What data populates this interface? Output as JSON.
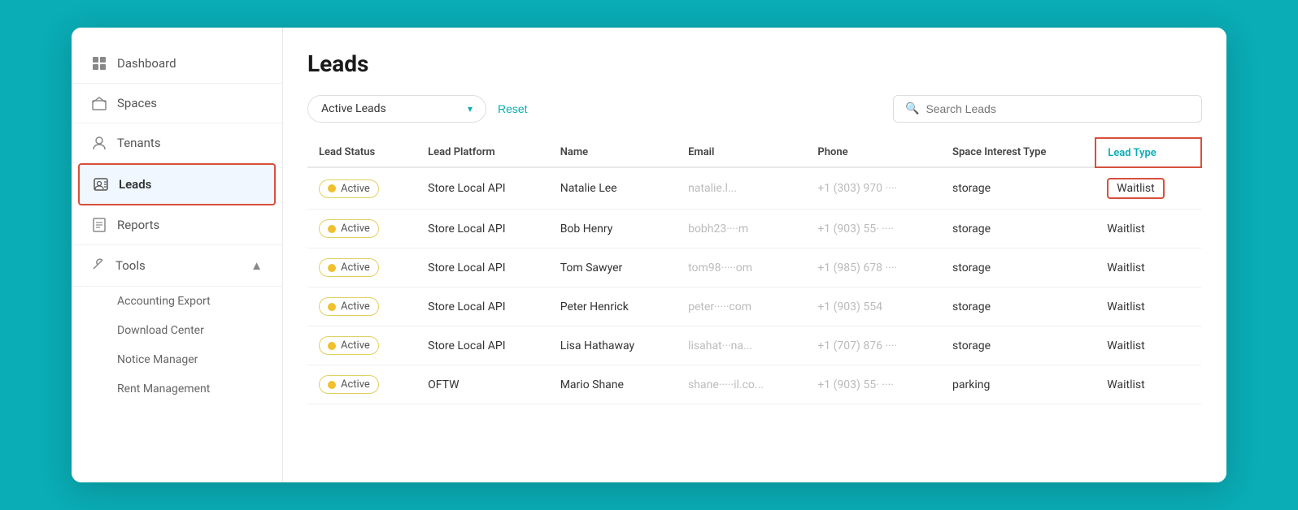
{
  "sidebar": {
    "items": [
      {
        "label": "Dashboard",
        "icon": "grid",
        "active": false
      },
      {
        "label": "Spaces",
        "icon": "building",
        "active": false
      },
      {
        "label": "Tenants",
        "icon": "person",
        "active": false
      },
      {
        "label": "Leads",
        "icon": "contact-card",
        "active": true
      },
      {
        "label": "Reports",
        "icon": "document",
        "active": false
      }
    ],
    "tools": {
      "label": "Tools",
      "icon": "wrench",
      "sub_items": [
        {
          "label": "Accounting Export"
        },
        {
          "label": "Download Center"
        },
        {
          "label": "Notice Manager"
        },
        {
          "label": "Rent Management"
        }
      ]
    }
  },
  "page": {
    "title": "Leads"
  },
  "toolbar": {
    "filter_label": "Active Leads",
    "filter_chevron": "▾",
    "reset_label": "Reset",
    "search_placeholder": "Search Leads"
  },
  "table": {
    "columns": [
      {
        "id": "lead_status",
        "label": "Lead Status"
      },
      {
        "id": "lead_platform",
        "label": "Lead Platform"
      },
      {
        "id": "name",
        "label": "Name"
      },
      {
        "id": "email",
        "label": "Email"
      },
      {
        "id": "phone",
        "label": "Phone"
      },
      {
        "id": "space_interest_type",
        "label": "Space Interest Type"
      },
      {
        "id": "lead_type",
        "label": "Lead Type",
        "highlight": true
      }
    ],
    "rows": [
      {
        "status": "Active",
        "platform": "Store Local API",
        "name": "Natalie Lee",
        "email": "natalie.l...",
        "phone": "+1 (303) 970 ····",
        "space_type": "storage",
        "lead_type": "Waitlist",
        "lead_type_highlight": true
      },
      {
        "status": "Active",
        "platform": "Store Local API",
        "name": "Bob Henry",
        "email": "bobh23····m",
        "phone": "+1 (903) 55· ····",
        "space_type": "storage",
        "lead_type": "Waitlist",
        "lead_type_highlight": false
      },
      {
        "status": "Active",
        "platform": "Store Local API",
        "name": "Tom Sawyer",
        "email": "tom98·····om",
        "phone": "+1 (985) 678 ····",
        "space_type": "storage",
        "lead_type": "Waitlist",
        "lead_type_highlight": false
      },
      {
        "status": "Active",
        "platform": "Store Local API",
        "name": "Peter Henrick",
        "email": "peter·····com",
        "phone": "+1 (903) 554",
        "space_type": "storage",
        "lead_type": "Waitlist",
        "lead_type_highlight": false
      },
      {
        "status": "Active",
        "platform": "Store Local API",
        "name": "Lisa Hathaway",
        "email": "lisahat···na...",
        "phone": "+1 (707) 876 ····",
        "space_type": "storage",
        "lead_type": "Waitlist",
        "lead_type_highlight": false
      },
      {
        "status": "Active",
        "platform": "OFTW",
        "name": "Mario Shane",
        "email": "shane·····il.co...",
        "phone": "+1 (903) 55· ····",
        "space_type": "parking",
        "lead_type": "Waitlist",
        "lead_type_highlight": false
      }
    ]
  }
}
